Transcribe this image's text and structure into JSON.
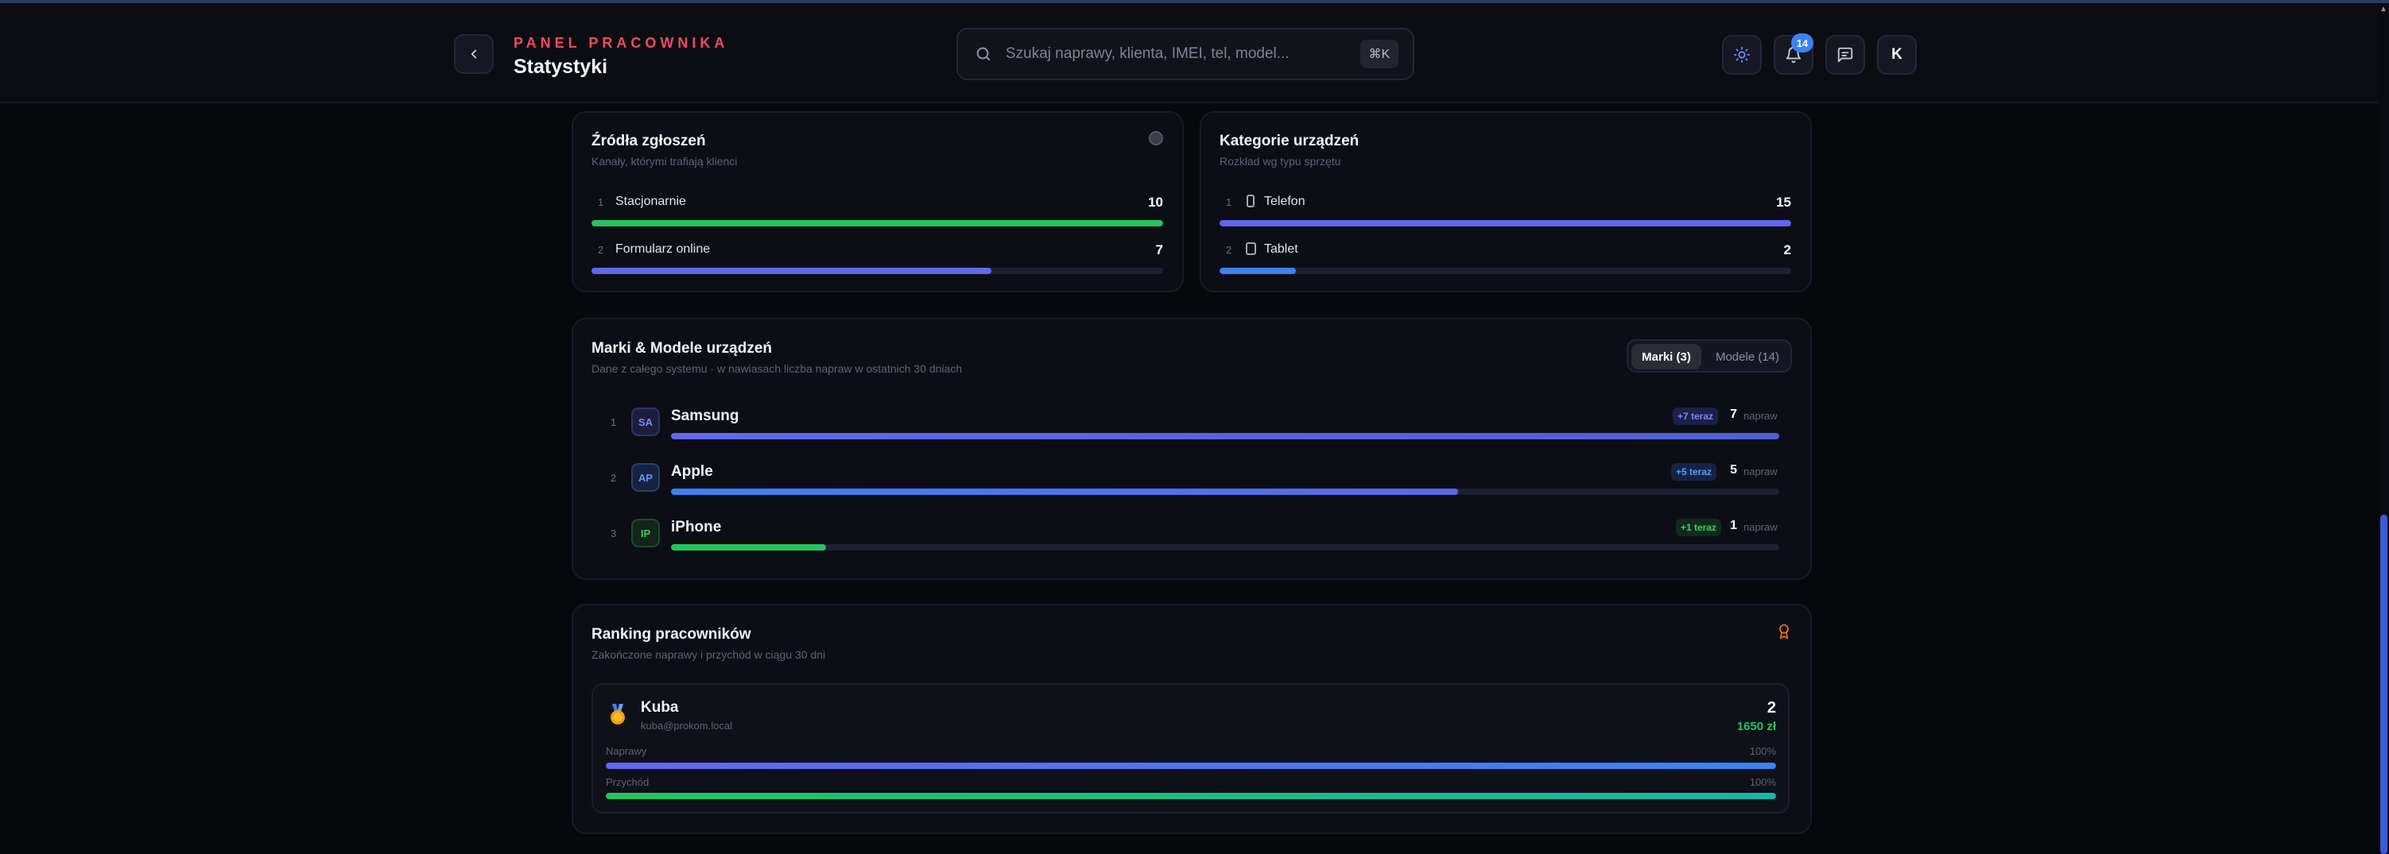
{
  "header": {
    "eyebrow": "PANEL PRACOWNIKA",
    "title": "Statystyki",
    "search_placeholder": "Szukaj naprawy, klienta, IMEI, tel, model...",
    "shortcut": "⌘K",
    "notifications_count": "14",
    "avatar_initial": "K"
  },
  "sources": {
    "title": "Źródła zgłoszeń",
    "subtitle": "Kanały, którymi trafiają klienci",
    "rows": [
      {
        "index": "1",
        "label": "Stacjonarnie",
        "value": "10",
        "fraction": 1.0
      },
      {
        "index": "2",
        "label": "Formularz online",
        "value": "7",
        "fraction": 0.7
      }
    ]
  },
  "categories": {
    "title": "Kategorie urządzeń",
    "subtitle": "Rozkład wg typu sprzętu",
    "rows": [
      {
        "index": "1",
        "icon": "phone-icon",
        "label": "Telefon",
        "value": "15",
        "fraction": 1.0
      },
      {
        "index": "2",
        "icon": "tablet-icon",
        "label": "Tablet",
        "value": "2",
        "fraction": 0.133
      }
    ]
  },
  "brands": {
    "title": "Marki & Modele urządzeń",
    "subtitle": "Dane z całego systemu · w nawiasach liczba napraw w ostatnich 30 dniach",
    "tab_brands": "Marki (3)",
    "tab_models": "Modele (14)",
    "unit": "napraw",
    "rows": [
      {
        "index": "1",
        "chip": "SA",
        "name": "Samsung",
        "delta": "+7 teraz",
        "count": "7",
        "fraction": 1.0
      },
      {
        "index": "2",
        "chip": "AP",
        "name": "Apple",
        "delta": "+5 teraz",
        "count": "5",
        "fraction": 0.71
      },
      {
        "index": "3",
        "chip": "IP",
        "name": "iPhone",
        "delta": "+1 teraz",
        "count": "1",
        "fraction": 0.14
      }
    ]
  },
  "ranking": {
    "title": "Ranking pracowników",
    "subtitle": "Zakończone naprawy i przychód w ciągu 30 dni",
    "employee": {
      "name": "Kuba",
      "email": "kuba@prokom.local",
      "repairs": "2",
      "revenue": "1650 zł",
      "repairs_label": "Naprawy",
      "repairs_pct": "100%",
      "revenue_label": "Przychód",
      "revenue_pct": "100%"
    }
  },
  "colors": {
    "accent_red": "#ef4b5f",
    "green": "#22c55e",
    "indigo": "#6366f1",
    "blue": "#3b82f6"
  }
}
